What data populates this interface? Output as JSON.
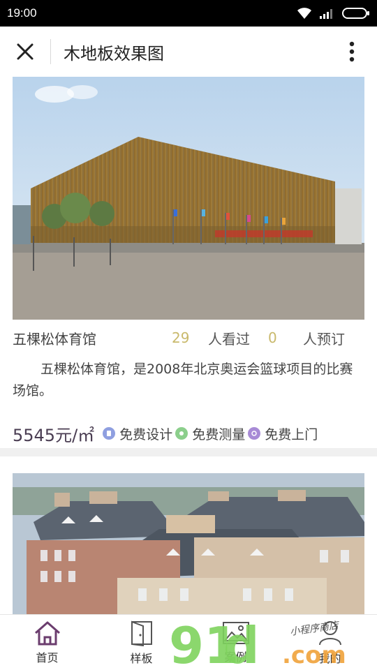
{
  "status": {
    "time": "19:00"
  },
  "header": {
    "title": "木地板效果图",
    "close_icon": "close-icon",
    "more_icon": "more-vertical-icon"
  },
  "cards": [
    {
      "name": "五棵松体育馆",
      "views_count": "29",
      "views_label": "人看过",
      "booked_count": "0",
      "booked_label": "人预订",
      "description": "五棵松体育馆，是2008年北京奥运会篮球项目的比赛场馆。",
      "price": "5545元/㎡",
      "services": [
        {
          "label": "免费设计",
          "icon": "design-icon",
          "color": "#8f9fe0"
        },
        {
          "label": "免费测量",
          "icon": "measure-icon",
          "color": "#8ccf8c"
        },
        {
          "label": "免费上门",
          "icon": "visit-icon",
          "color": "#a88bd6"
        }
      ]
    }
  ],
  "nav": {
    "items": [
      {
        "label": "首页",
        "icon": "home-icon",
        "active": true
      },
      {
        "label": "样板",
        "icon": "door-icon"
      },
      {
        "label": "案例",
        "icon": "image-icon"
      },
      {
        "label": "我的",
        "icon": "user-icon"
      }
    ]
  },
  "watermark": {
    "main": "91",
    "suffix": ".com",
    "tagline": "小程序商店"
  },
  "colors": {
    "accent": "#6b3d6e",
    "count": "#c9b96c",
    "watermark_green": "#7fd35e",
    "watermark_orange": "#f0a23a"
  }
}
